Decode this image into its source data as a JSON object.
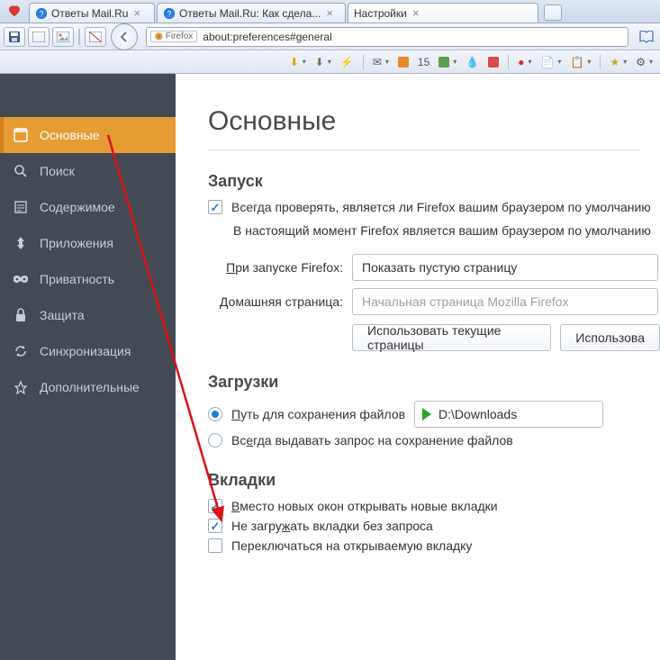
{
  "tabs": {
    "t1": "Ответы Mail.Ru",
    "t2": "Ответы Mail.Ru: Как сдела...",
    "t3": "Настройки"
  },
  "url": {
    "identity": "Firefox",
    "address": "about:preferences#general"
  },
  "toolbar2": {
    "count": "15"
  },
  "sidebar": {
    "items": {
      "general": "Основные",
      "search": "Поиск",
      "content": "Содержимое",
      "apps": "Приложения",
      "privacy": "Приватность",
      "security": "Защита",
      "sync": "Синхронизация",
      "advanced": "Дополнительные"
    }
  },
  "page": {
    "title": "Основные",
    "startup": {
      "heading": "Запуск",
      "always_check": "Всегда проверять, является ли Firefox вашим браузером по умолчанию",
      "is_default": "В настоящий момент Firefox является вашим браузером по умолчанию",
      "on_start_label": "При запуске Firefox:",
      "on_start_value": "Показать пустую страницу",
      "home_label": "Домашняя страница:",
      "home_placeholder": "Начальная страница Mozilla Firefox",
      "use_current": "Использовать текущие страницы",
      "use_bookmark": "Использова"
    },
    "downloads": {
      "heading": "Загрузки",
      "save_to": "Путь для сохранения файлов",
      "path": "D:\\Downloads",
      "always_ask": "Всегда выдавать запрос на сохранение файлов"
    },
    "tabs_section": {
      "heading": "Вкладки",
      "opt1": "Вместо новых окон открывать новые вкладки",
      "opt2": "Не загружать вкладки без запроса",
      "opt3": "Переключаться на открываемую вкладку"
    }
  }
}
